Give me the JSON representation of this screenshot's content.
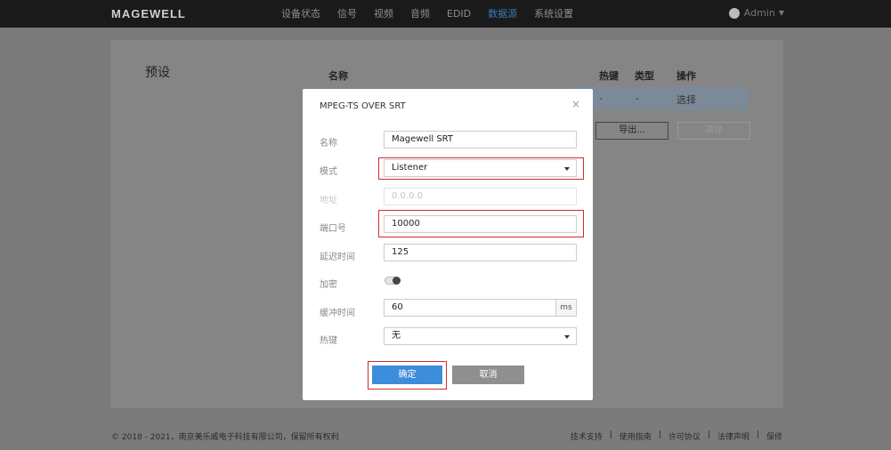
{
  "header": {
    "logo": "MAGEWELL",
    "nav": [
      "设备状态",
      "信号",
      "视频",
      "音频",
      "EDID",
      "数据源",
      "系统设置"
    ],
    "active_nav": "数据源",
    "user": "Admin"
  },
  "main": {
    "preset_title": "预设",
    "table_headers": {
      "name": "名称",
      "hotkey": "热键",
      "type": "类型",
      "action": "操作"
    },
    "row": {
      "hotkey": "-",
      "type": "-",
      "action": "选择"
    },
    "export_label": "导出...",
    "clear_label": "清除"
  },
  "footer": {
    "copyright": "© 2018 - 2021，南京美乐威电子科技有限公司，保留所有权利",
    "links": [
      "技术支持",
      "使用指南",
      "许可协议",
      "法律声明",
      "保修"
    ]
  },
  "modal": {
    "title": "MPEG-TS OVER SRT",
    "close": "×",
    "name_label": "名称",
    "name_value": "Magewell SRT",
    "mode_label": "模式",
    "mode_value": "Listener",
    "address_label": "地址",
    "address_value": "0.0.0.0",
    "port_label": "端口号",
    "port_value": "10000",
    "latency_label": "延迟时间",
    "latency_value": "125",
    "encrypt_label": "加密",
    "encrypt_enabled": false,
    "buffer_label": "缓冲时间",
    "buffer_value": "60",
    "buffer_unit": "ms",
    "hotkey_label": "热键",
    "hotkey_value": "无",
    "ok_label": "确定",
    "cancel_label": "取消"
  },
  "colors": {
    "accent": "#3d8ddb",
    "highlight": "#d42a2a",
    "active_nav": "#3a78b8"
  }
}
